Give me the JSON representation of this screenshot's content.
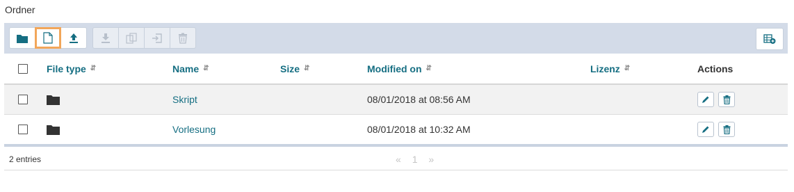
{
  "page": {
    "title": "Ordner"
  },
  "toolbar": {
    "buttons": [
      {
        "name": "new-folder",
        "icon": "folder-icon",
        "enabled": true
      },
      {
        "name": "new-file",
        "icon": "file-icon",
        "enabled": true,
        "highlighted": true
      },
      {
        "name": "upload",
        "icon": "upload-icon",
        "enabled": true
      },
      {
        "name": "download",
        "icon": "download-icon",
        "enabled": false
      },
      {
        "name": "copy",
        "icon": "copy-icon",
        "enabled": false
      },
      {
        "name": "move",
        "icon": "move-icon",
        "enabled": false
      },
      {
        "name": "delete",
        "icon": "trash-icon",
        "enabled": false
      }
    ],
    "right_button": {
      "icon": "table-settings-icon"
    }
  },
  "table": {
    "columns": [
      "File type",
      "Name",
      "Size",
      "Modified on",
      "Lizenz",
      "Actions"
    ],
    "rows": [
      {
        "type_icon": "folder-icon",
        "name": "Skript",
        "size": "",
        "modified": "08/01/2018 at 08:56 AM",
        "license": ""
      },
      {
        "type_icon": "folder-icon",
        "name": "Vorlesung",
        "size": "",
        "modified": "08/01/2018 at 10:32 AM",
        "license": ""
      }
    ]
  },
  "footer": {
    "entries": "2 entries",
    "pager": {
      "prev": "«",
      "page": "1",
      "next": "»"
    }
  },
  "colors": {
    "accent": "#156e82",
    "toolbar_bg": "#d3dbe8",
    "highlight": "#f2a65a"
  }
}
